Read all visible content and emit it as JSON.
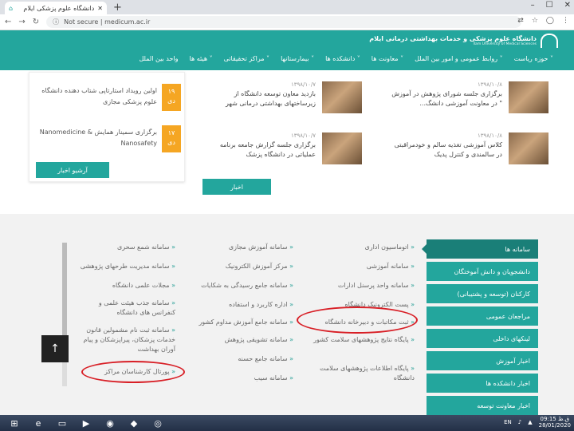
{
  "browser": {
    "tab_title": "دانشگاه علوم پزشکی ایلام",
    "address": "Not secure | medicum.ac.ir",
    "win_min": "–",
    "win_max": "☐",
    "win_close": "✕"
  },
  "site": {
    "logo_fa": "دانشگاه علوم پزشکی و خدمات بهداشتی درمانی ایلام",
    "logo_en": "Ilam University of Medical Sciences",
    "menu": [
      "حوزه ریاست ˅",
      "روابط عمومی و امور بین الملل ˅",
      "معاونت ها ˅",
      "دانشکده ها ˅",
      "بیمارستانها ˅",
      "مراکز تحقیقاتی ˅",
      "هیئه ها ˅",
      "واحد بین الملل"
    ]
  },
  "events": [
    {
      "day": "۱۹",
      "month": "دی",
      "title": "اولین رویداد استارتاپی شتاب دهنده دانشگاه علوم پزشکی مجازی"
    },
    {
      "day": "۱۷",
      "month": "دی",
      "title": "برگزاری سمینار همایش Nanomedicine & Nanosafety"
    }
  ],
  "archive_events": "آرشیو اخبار",
  "archive_news": "اخبار",
  "news": [
    {
      "date": "۱۳۹۸/۱۰/۸",
      "title": "برگزاری جلسه شورای پژوهش در آموزش \" در معاونت آموزشی دانشگ..."
    },
    {
      "date": "۱۳۹۸/۱۰/۷",
      "title": "بازدید معاون توسعه دانشگاه از زیرساختهای بهداشتی درمانی شهر"
    },
    {
      "date": "۱۳۹۸/۱۰/۸",
      "title": "کلاس آموزشی تغذیه سالم و خودمراقبتی در سالمندی و کنترل پدیک"
    },
    {
      "date": "۱۳۹۸/۱۰/۷",
      "title": "برگزاری جلسه گزارش جامعه برنامه عملیاتی در دانشگاه پزشک"
    }
  ],
  "side_menu": [
    "سامانه ها",
    "دانشجویان و دانش آموختگان",
    "کارکنان (توسعه و پشتیبانی)",
    "مراجعان عمومی",
    "لینکهای داخلی",
    "اخبار آموزش",
    "اخبار دانشکده ها",
    "اخبار معاونت توسعه"
  ],
  "links_col1": [
    "اتوماسیون اداری",
    "سامانه آموزشی",
    "سامانه واحد پرسنل ادارات",
    "پست الکترونیک دانشگاه",
    "ثبت مکاتبات و دبیرخانه دانشگاه",
    "پایگاه نتایج پژوهشهای سلامت کشور",
    "پایگاه اطلاعات پژوهشهای سلامت دانشگاه"
  ],
  "links_col2": [
    "سامانه آموزش مجازی",
    "مرکز آموزش الکترونیک",
    "سامانه جامع رسیدگی به شکایات",
    "اداره کاربرد و استفاده",
    "سامانه جامع آموزش مداوم کشور",
    "سامانه تشویقی پژوهش",
    "سامانه جامع حسنه",
    "سامانه سیب"
  ],
  "links_col3": [
    "سامانه شمع سحری",
    "سامانه مدیریت طرحهای پژوهشی",
    "مجلات علمی دانشگاه",
    "سامانه جذب هیئت علمی و کنفرانس های دانشگاه",
    "سامانه ثبت نام مشمولین قانون خدمات پزشکان، پیراپزشکان و پیام آوران بهداشت",
    "پورتال کارشناسان مراکز"
  ],
  "back_top": "↑",
  "tray": {
    "lang": "EN",
    "time": "09:15 ق.ظ",
    "date": "28/01/2020"
  }
}
